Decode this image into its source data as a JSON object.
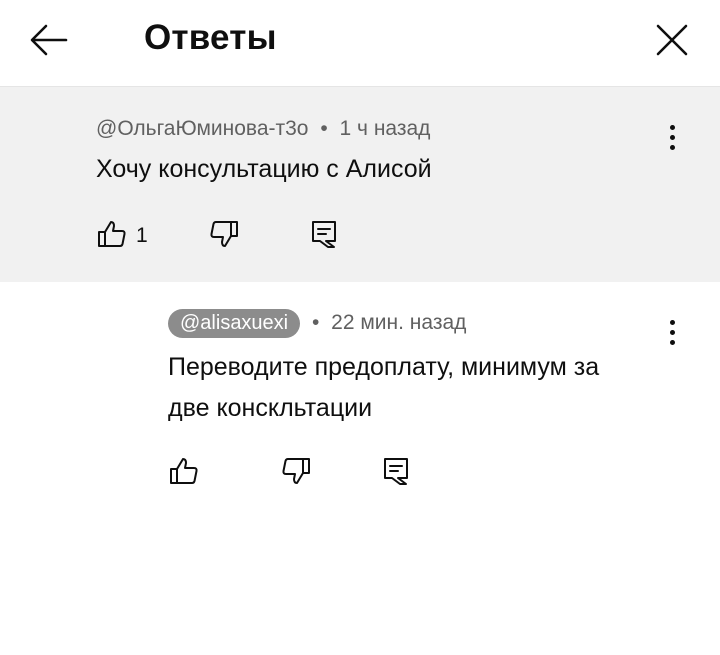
{
  "header": {
    "title": "Ответы",
    "back_icon": "arrow-left-icon",
    "close_icon": "close-icon"
  },
  "parent_comment": {
    "author": "@ОльгаЮминова-т3о",
    "separator": "•",
    "time": "1 ч назад",
    "text": "Хочу консультацию с Алисой",
    "likes": "1"
  },
  "reply": {
    "author": "@alisaxuexi",
    "separator": "•",
    "time": "22 мин. назад",
    "text_line1": "Переводите предоплату, минимум за",
    "text_line2": "две конскльтации"
  },
  "colors": {
    "parent_bg": "#f1f1f1",
    "chip_bg": "#8c8c8c",
    "meta_text": "#606060"
  }
}
